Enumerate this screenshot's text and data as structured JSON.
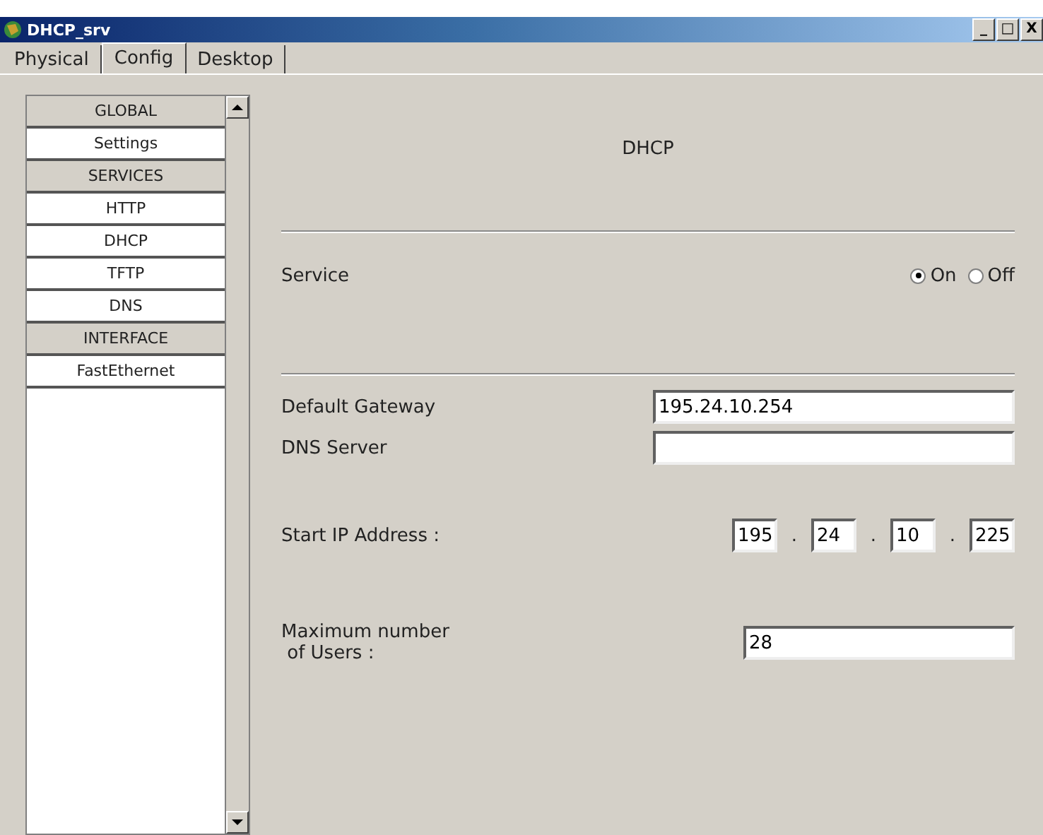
{
  "window": {
    "title": "DHCP_srv",
    "controls": [
      "_",
      "□",
      "X"
    ]
  },
  "tabs": [
    {
      "label": "Physical",
      "selected": false
    },
    {
      "label": "Config",
      "selected": true
    },
    {
      "label": "Desktop",
      "selected": false
    }
  ],
  "sidebar": {
    "items": [
      {
        "label": "GLOBAL",
        "kind": "header"
      },
      {
        "label": "Settings",
        "kind": "item"
      },
      {
        "label": "SERVICES",
        "kind": "header"
      },
      {
        "label": "HTTP",
        "kind": "item"
      },
      {
        "label": "DHCP",
        "kind": "item"
      },
      {
        "label": "TFTP",
        "kind": "item"
      },
      {
        "label": "DNS",
        "kind": "item"
      },
      {
        "label": "INTERFACE",
        "kind": "header"
      },
      {
        "label": "FastEthernet",
        "kind": "item"
      }
    ]
  },
  "content": {
    "heading": "DHCP",
    "service": {
      "label": "Service",
      "options": [
        {
          "label": "On",
          "selected": true
        },
        {
          "label": "Off",
          "selected": false
        }
      ]
    },
    "default_gateway": {
      "label": "Default Gateway",
      "value": "195.24.10.254"
    },
    "dns_server": {
      "label": "DNS Server"
    },
    "start_ip": {
      "label": "Start IP Address :",
      "octets": [
        "195",
        "24",
        "10",
        "225"
      ],
      "separator": "."
    },
    "max_users": {
      "label": "Maximum number\n of Users :",
      "value": "28"
    }
  }
}
